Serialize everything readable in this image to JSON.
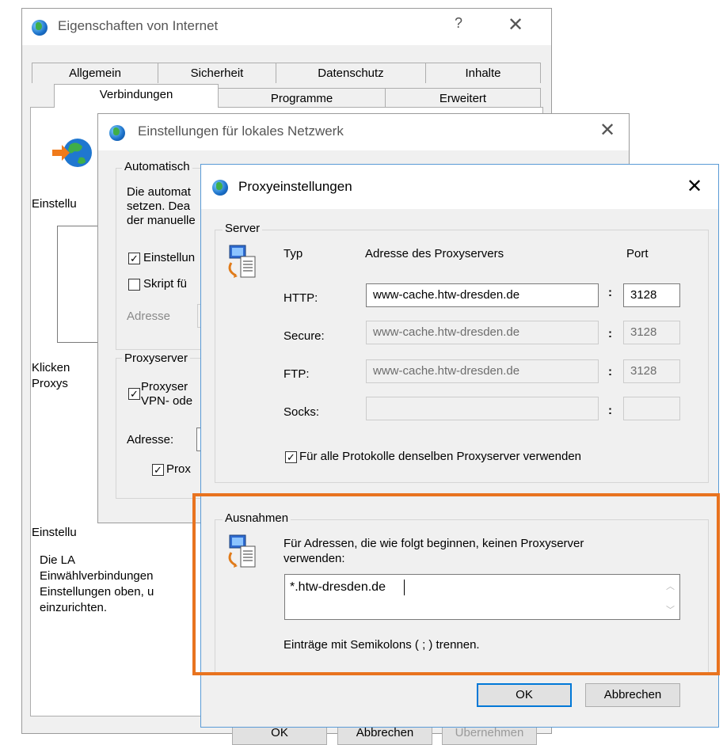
{
  "win1": {
    "title": "Eigenschaften von Internet",
    "help": "?",
    "close": "✕",
    "tabs_row1": [
      "Allgemein",
      "Sicherheit",
      "Datenschutz",
      "Inhalte"
    ],
    "tabs_row2": [
      "Verbindungen",
      "Programme",
      "Erweitert"
    ],
    "partial": {
      "einstell1": "Einstellu",
      "klicken": "Klicken",
      "proxys": "Proxys",
      "einstell2": "Einstellu",
      "die_la": "Die LA",
      "einwahl": "Einwählverbindungen",
      "einst_oben": "Einstellungen oben, u",
      "einzurichten": "einzurichten."
    },
    "bottom_buttons": [
      "OK",
      "Abbrechen",
      "Übernehmen"
    ]
  },
  "win2": {
    "title": "Einstellungen für lokales Netzwerk",
    "close": "✕",
    "auto_group": "Automatisch",
    "auto_text1": "Die automat",
    "auto_text2": "setzen. Dea",
    "auto_text3": "der manuelle",
    "cb_einstell": "Einstellun",
    "cb_skript": "Skript fü",
    "adresse_lbl": "Adresse",
    "proxy_group": "Proxyserver",
    "cb_proxy_line1": "Proxyser",
    "cb_proxy_line2": "VPN- ode",
    "adresse2_lbl": "Adresse:",
    "cb_prox": "Prox"
  },
  "win3": {
    "title": "Proxyeinstellungen",
    "close": "✕",
    "server_group": "Server",
    "col_typ": "Typ",
    "col_addr": "Adresse des Proxyservers",
    "col_port": "Port",
    "rows": [
      {
        "label": "HTTP:",
        "address": "www-cache.htw-dresden.de",
        "port": "3128"
      },
      {
        "label": "Secure:",
        "address": "www-cache.htw-dresden.de",
        "port": "3128"
      },
      {
        "label": "FTP:",
        "address": "www-cache.htw-dresden.de",
        "port": "3128"
      },
      {
        "label": "Socks:",
        "address": "",
        "port": ""
      }
    ],
    "colon": ":",
    "same_proxy_label": "Für alle Protokolle denselben Proxyserver verwenden",
    "ausnahmen_group": "Ausnahmen",
    "ausnahmen_text_line1": "Für Adressen, die wie folgt beginnen, keinen Proxyserver",
    "ausnahmen_text_line2": "verwenden:",
    "exceptions_value": "*.htw-dresden.de",
    "semicolon_hint": "Einträge mit Semikolons ( ; ) trennen.",
    "ok": "OK",
    "cancel": "Abbrechen"
  },
  "colors": {
    "highlight": "#e8731f",
    "accent": "#0078d7"
  }
}
